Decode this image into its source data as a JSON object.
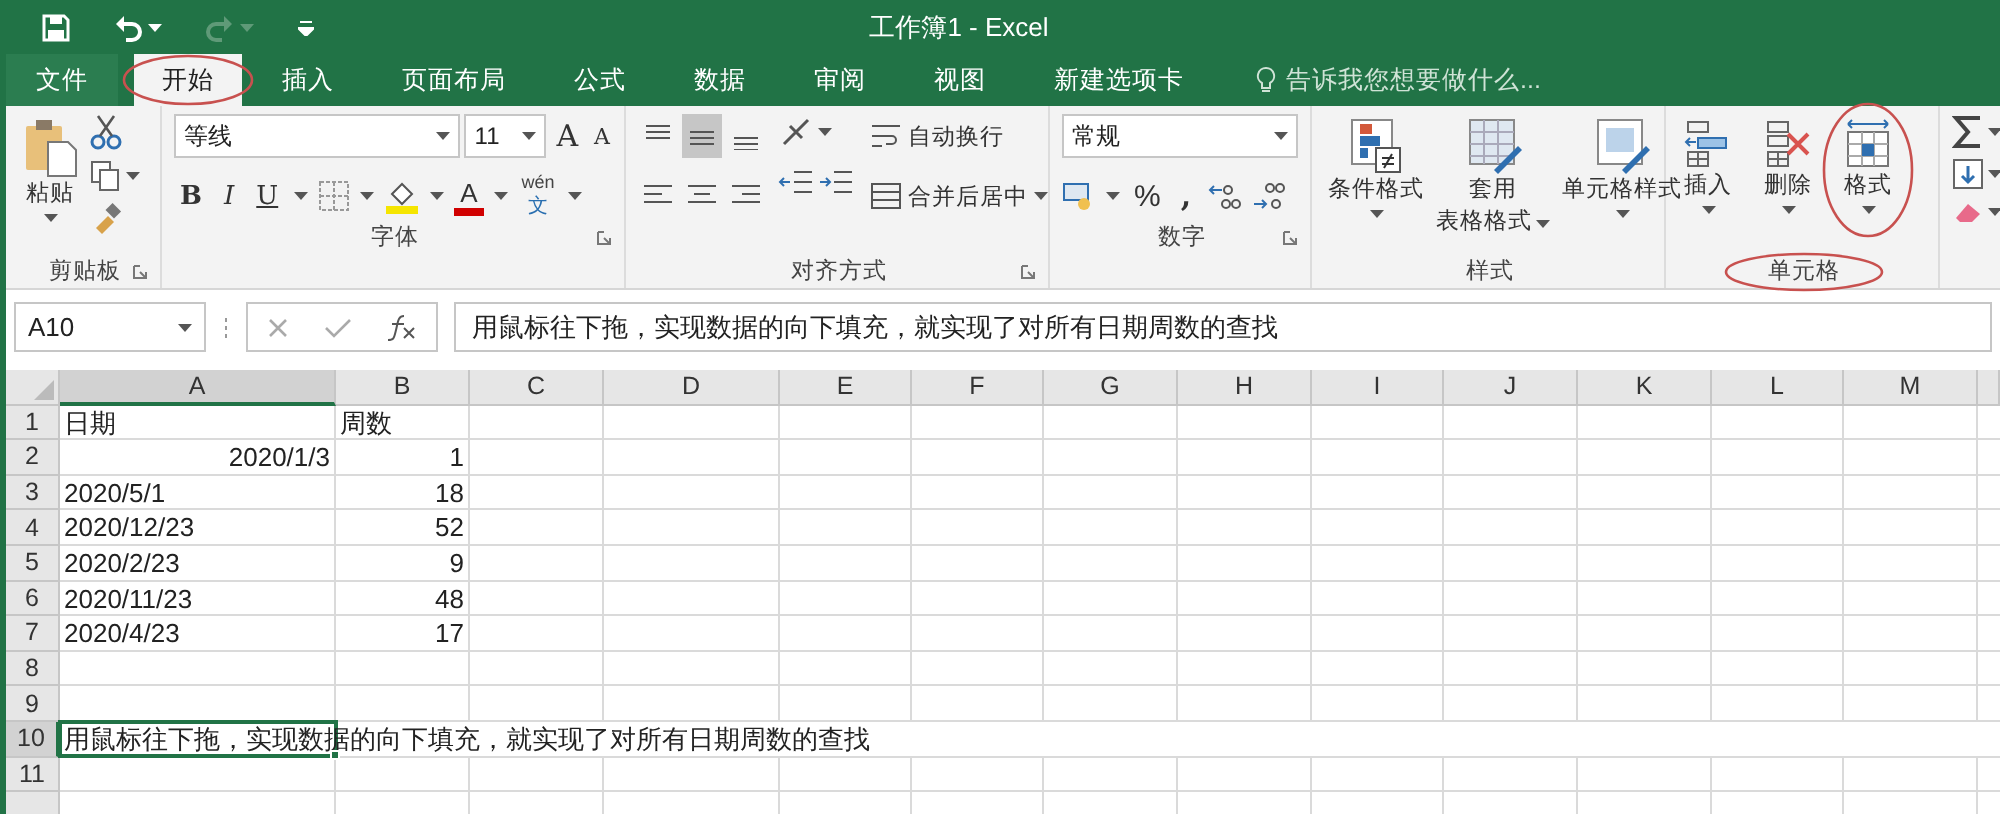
{
  "title_bar": {
    "title": "工作簿1 - Excel"
  },
  "tabs": [
    {
      "label": "文件",
      "kind": "file",
      "selected": false,
      "circled": false
    },
    {
      "label": "开始",
      "kind": "tab",
      "selected": true,
      "circled": true
    },
    {
      "label": "插入",
      "kind": "tab",
      "selected": false,
      "circled": false
    },
    {
      "label": "页面布局",
      "kind": "tab",
      "selected": false,
      "circled": false
    },
    {
      "label": "公式",
      "kind": "tab",
      "selected": false,
      "circled": false
    },
    {
      "label": "数据",
      "kind": "tab",
      "selected": false,
      "circled": false
    },
    {
      "label": "审阅",
      "kind": "tab",
      "selected": false,
      "circled": false
    },
    {
      "label": "视图",
      "kind": "tab",
      "selected": false,
      "circled": false
    },
    {
      "label": "新建选项卡",
      "kind": "tab",
      "selected": false,
      "circled": false
    }
  ],
  "tell_me": {
    "placeholder": "告诉我您想要做什么..."
  },
  "ribbon": {
    "clipboard": {
      "label": "剪贴板",
      "paste": "粘贴"
    },
    "font": {
      "label": "字体",
      "font_name": "等线",
      "font_size": "11",
      "grow": "A",
      "shrink": "A",
      "bold": "B",
      "italic": "I",
      "underline": "U",
      "font_color": "A",
      "phonetic_top": "wén",
      "phonetic_bottom": "文"
    },
    "alignment": {
      "label": "对齐方式",
      "wrap": "自动换行",
      "merge": "合并后居中"
    },
    "number": {
      "label": "数字",
      "format": "常规",
      "percent": "%",
      "comma": ","
    },
    "styles": {
      "label": "样式",
      "conditional": "条件格式",
      "table_top": "套用",
      "table_bottom": "表格格式",
      "cell_styles": "单元格样式"
    },
    "cells": {
      "label": "单元格",
      "label_circled": true,
      "items": [
        {
          "label": "插入",
          "kind": "insert",
          "circled": false
        },
        {
          "label": "删除",
          "kind": "delete",
          "circled": false
        },
        {
          "label": "格式",
          "kind": "format",
          "circled": true
        }
      ]
    }
  },
  "formula_bar": {
    "name_box": "A10",
    "value": "用鼠标往下拖，实现数据的向下填充，就实现了对所有日期周数的查找"
  },
  "sheet": {
    "columns": [
      "A",
      "B",
      "C",
      "D",
      "E",
      "F",
      "G",
      "H",
      "I",
      "J",
      "K",
      "L",
      "M"
    ],
    "rows": [
      {
        "number": "1",
        "cells": [
          {
            "text": "日期",
            "kind": "text",
            "selected": false,
            "spill": false
          },
          {
            "text": "周数",
            "kind": "text",
            "selected": false,
            "spill": false
          }
        ]
      },
      {
        "number": "2",
        "cells": [
          {
            "text": "2020/1/3",
            "kind": "date",
            "selected": false,
            "spill": false
          },
          {
            "text": "1",
            "kind": "number",
            "selected": false,
            "spill": false
          }
        ]
      },
      {
        "number": "3",
        "cells": [
          {
            "text": "2020/5/1",
            "kind": "text",
            "selected": false,
            "spill": false
          },
          {
            "text": "18",
            "kind": "number",
            "selected": false,
            "spill": false
          }
        ]
      },
      {
        "number": "4",
        "cells": [
          {
            "text": "2020/12/23",
            "kind": "text",
            "selected": false,
            "spill": false
          },
          {
            "text": "52",
            "kind": "number",
            "selected": false,
            "spill": false
          }
        ]
      },
      {
        "number": "5",
        "cells": [
          {
            "text": "2020/2/23",
            "kind": "text",
            "selected": false,
            "spill": false
          },
          {
            "text": "9",
            "kind": "number",
            "selected": false,
            "spill": false
          }
        ]
      },
      {
        "number": "6",
        "cells": [
          {
            "text": "2020/11/23",
            "kind": "text",
            "selected": false,
            "spill": false
          },
          {
            "text": "48",
            "kind": "number",
            "selected": false,
            "spill": false
          }
        ]
      },
      {
        "number": "7",
        "cells": [
          {
            "text": "2020/4/23",
            "kind": "text",
            "selected": false,
            "spill": false
          },
          {
            "text": "17",
            "kind": "number",
            "selected": false,
            "spill": false
          }
        ]
      },
      {
        "number": "8",
        "cells": []
      },
      {
        "number": "9",
        "cells": []
      },
      {
        "number": "10",
        "cells": [
          {
            "text": "用鼠标往下拖，实现数据的向下填充，就实现了对所有日期周数的查找",
            "kind": "text",
            "selected": true,
            "spill": true
          }
        ]
      },
      {
        "number": "11",
        "cells": []
      },
      {
        "cells": []
      }
    ]
  }
}
